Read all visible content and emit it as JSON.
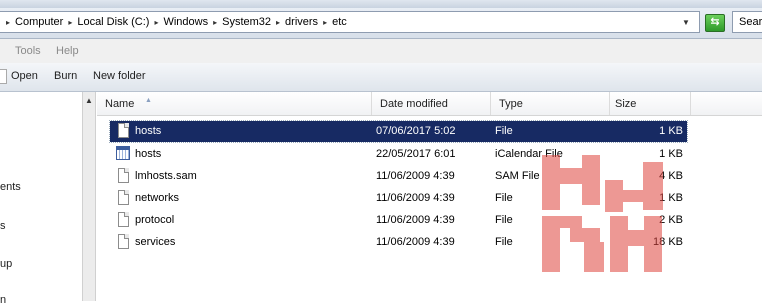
{
  "address": {
    "crumbs": [
      "Computer",
      "Local Disk (C:)",
      "Windows",
      "System32",
      "drivers",
      "etc"
    ],
    "search_placeholder": "Sear"
  },
  "menu": {
    "tools": "Tools",
    "help": "Help"
  },
  "toolbar": {
    "open": "Open",
    "burn": "Burn",
    "new_folder": "New folder"
  },
  "nav": {
    "items": [
      "ents",
      "s",
      "up",
      "n"
    ]
  },
  "columns": {
    "name": "Name",
    "date": "Date modified",
    "type": "Type",
    "size": "Size"
  },
  "files": [
    {
      "name": "hosts",
      "date": "07/06/2017 5:02",
      "type": "File",
      "size": "1 KB",
      "icon": "file-icon",
      "selected": true
    },
    {
      "name": "hosts",
      "date": "22/05/2017 6:01",
      "type": "iCalendar File",
      "size": "1 KB",
      "icon": "calendar-file-icon",
      "selected": false
    },
    {
      "name": "lmhosts.sam",
      "date": "11/06/2009 4:39",
      "type": "SAM File",
      "size": "4 KB",
      "icon": "file-icon",
      "selected": false
    },
    {
      "name": "networks",
      "date": "11/06/2009 4:39",
      "type": "File",
      "size": "1 KB",
      "icon": "file-icon",
      "selected": false
    },
    {
      "name": "protocol",
      "date": "11/06/2009 4:39",
      "type": "File",
      "size": "2 KB",
      "icon": "file-icon",
      "selected": false
    },
    {
      "name": "services",
      "date": "11/06/2009 4:39",
      "type": "File",
      "size": "18 KB",
      "icon": "file-icon",
      "selected": false
    }
  ],
  "colors": {
    "selection": "#172a63",
    "watermark": "#e0443e",
    "refresh": "#2e9a2a"
  }
}
